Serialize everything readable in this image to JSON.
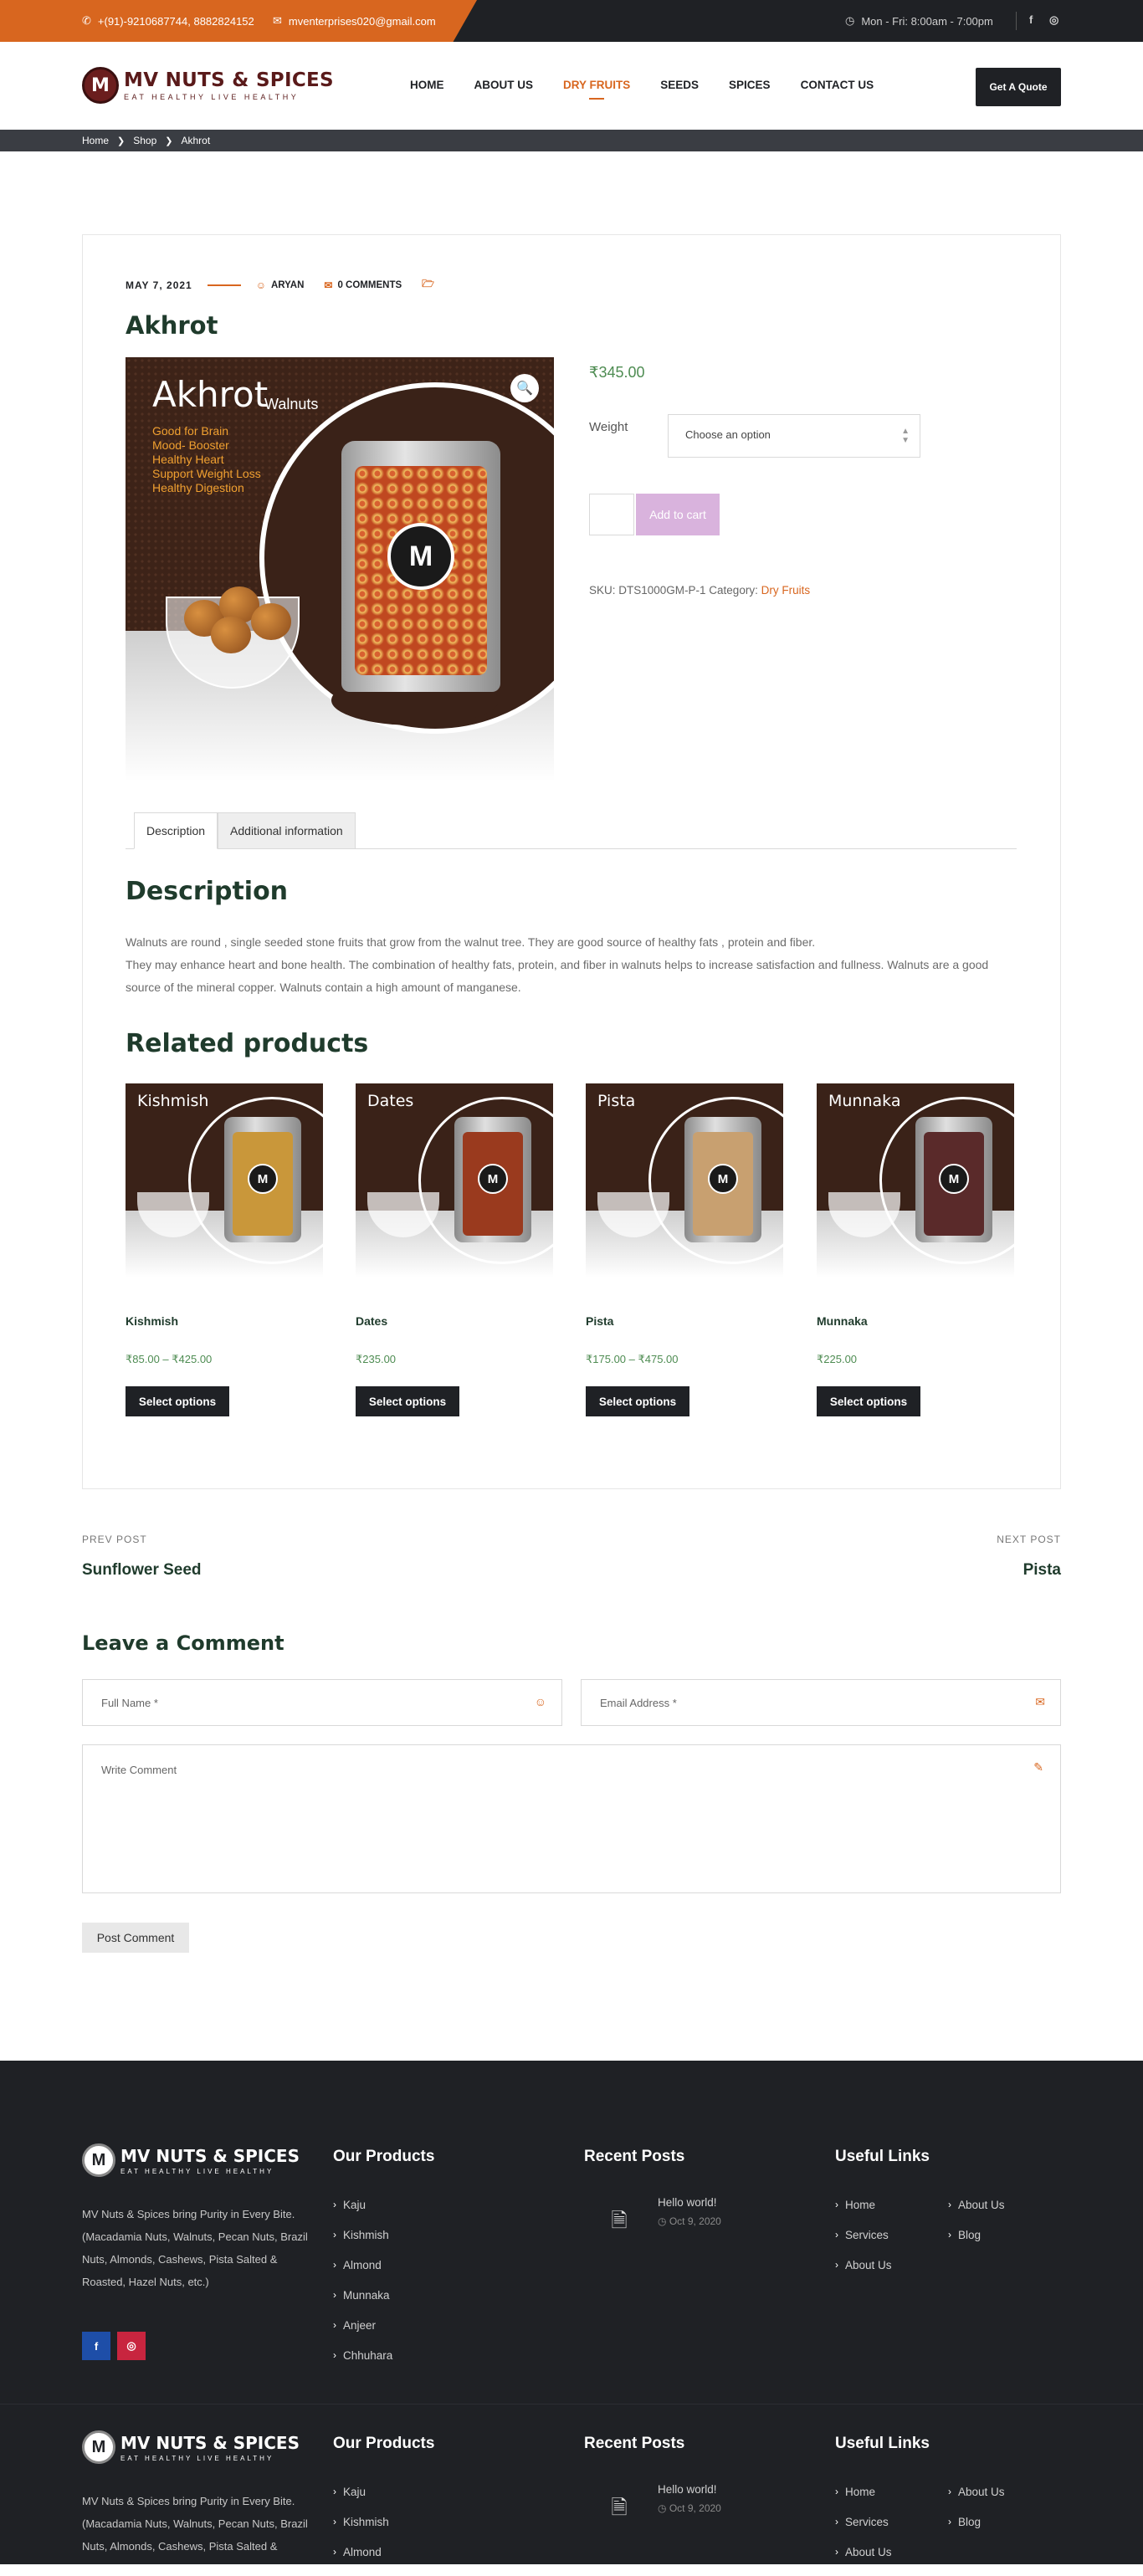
{
  "topbar": {
    "phone": "+(91)-9210687744, 8882824152",
    "email": "mventerprises020@gmail.com",
    "hours": "Mon - Fri: 8:00am - 7:00pm"
  },
  "brand": {
    "name": "MV NUTS & SPICES",
    "tagline": "EAT HEALTHY LIVE HEALTHY",
    "mark": "M"
  },
  "nav": {
    "items": [
      "HOME",
      "ABOUT US",
      "DRY FRUITS",
      "SEEDS",
      "SPICES",
      "CONTACT US"
    ],
    "active": "DRY FRUITS",
    "cta": "Get A Quote"
  },
  "breadcrumb": [
    "Home",
    "Shop",
    "Akhrot"
  ],
  "post": {
    "date": "MAY 7, 2021",
    "author": "ARYAN",
    "comments": "0 COMMENTS",
    "title": "Akhrot"
  },
  "product_image": {
    "title": "Akhrot",
    "subtitle": "-Walnuts",
    "bullets": [
      "Good for Brain",
      "Mood- Booster",
      "Healthy Heart",
      "Support Weight Loss",
      "Healthy Digestion"
    ]
  },
  "product": {
    "price": "₹345.00",
    "weight_label": "Weight",
    "weight_placeholder": "Choose an option",
    "add_to_cart": "Add to cart",
    "sku_text": "SKU: DTS1000GM-P-1 Category:",
    "category": "Dry Fruits"
  },
  "tabs": [
    "Description",
    "Additional information"
  ],
  "description": {
    "heading": "Description",
    "p1": "Walnuts are round , single seeded stone fruits that grow from the walnut tree. They are good source of healthy fats , protein and fiber.",
    "p2": "They may enhance heart and bone health. The combination of healthy fats, protein, and fiber in walnuts helps to increase satisfaction and fullness. Walnuts are a good source of the mineral copper. Walnuts contain a high amount of manganese."
  },
  "related": {
    "heading": "Related products",
    "items": [
      {
        "img_title": "Kishmish",
        "name": "Kishmish",
        "price": "₹85.00 – ₹425.00",
        "button": "Select options",
        "color": "#c9973a"
      },
      {
        "img_title": "Dates",
        "name": "Dates",
        "price": "₹235.00",
        "button": "Select options",
        "color": "#9a3a1e"
      },
      {
        "img_title": "Pista",
        "name": "Pista",
        "price": "₹175.00 – ₹475.00",
        "button": "Select options",
        "color": "#c8a070"
      },
      {
        "img_title": "Munnaka",
        "name": "Munnaka",
        "price": "₹225.00",
        "button": "Select options",
        "color": "#5a2a2a"
      }
    ]
  },
  "post_nav": {
    "prev_label": "PREV POST",
    "prev_title": "Sunflower Seed",
    "next_label": "NEXT POST",
    "next_title": "Pista"
  },
  "comment_form": {
    "heading": "Leave a Comment",
    "name_placeholder": "Full Name *",
    "email_placeholder": "Email Address *",
    "comment_placeholder": "Write Comment",
    "submit": "Post Comment"
  },
  "footer": {
    "about": "MV Nuts & Spices bring Purity in Every Bite. (Macadamia Nuts, Walnuts, Pecan Nuts, Brazil Nuts, Almonds, Cashews, Pista Salted & Roasted, Hazel Nuts, etc.)",
    "about_short": "MV Nuts & Spices bring Purity in Every Bite. (Macadamia Nuts, Walnuts, Pecan Nuts, Brazil Nuts, Almonds, Cashews, Pista Salted &",
    "products_heading": "Our Products",
    "products": [
      "Kaju",
      "Kishmish",
      "Almond",
      "Munnaka",
      "Anjeer",
      "Chhuhara"
    ],
    "recent_heading": "Recent Posts",
    "recent_post_title": "Hello world!",
    "recent_post_date": "Oct 9, 2020",
    "links_heading": "Useful Links",
    "links_col1": [
      "Home",
      "Services",
      "About Us"
    ],
    "links_col2": [
      "About Us",
      "Blog"
    ],
    "social": [
      "f",
      "ig"
    ]
  }
}
